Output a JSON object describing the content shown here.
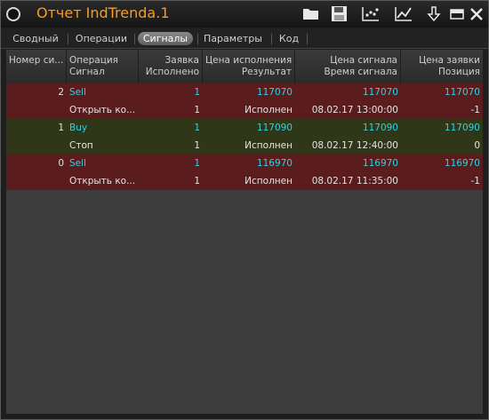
{
  "window": {
    "title": "Отчет IndTrenda.1"
  },
  "toolbar": {
    "icons": [
      "open-folder-icon",
      "save-icon",
      "scatter-chart-icon",
      "line-chart-icon",
      "download-arrow-icon",
      "minimize-icon",
      "close-icon"
    ]
  },
  "tabs": [
    {
      "label": "Сводный"
    },
    {
      "label": "Операции"
    },
    {
      "label": "Сигналы",
      "active": true
    },
    {
      "label": "Параметры"
    },
    {
      "label": "Код"
    }
  ],
  "columns": [
    {
      "line1": "Номер си...",
      "line2": ""
    },
    {
      "line1": "Операция",
      "line2": "Сигнал"
    },
    {
      "line1": "Заявка",
      "line2": "Исполнено"
    },
    {
      "line1": "Цена исполнения",
      "line2": "Результат"
    },
    {
      "line1": "Цена сигнала",
      "line2": "Время сигнала"
    },
    {
      "line1": "Цена заявки",
      "line2": "Позиция"
    }
  ],
  "signals": [
    {
      "top": [
        "2",
        "Sell",
        "1",
        "117070",
        "117070",
        "117070"
      ],
      "bottom": [
        "",
        "Открыть ко...",
        "1",
        "Исполнен",
        "08.02.17 13:00:00",
        "-1"
      ]
    },
    {
      "top": [
        "1",
        "Buy",
        "1",
        "117090",
        "117090",
        "117090"
      ],
      "bottom": [
        "",
        "Стоп",
        "1",
        "Исполнен",
        "08.02.17 12:40:00",
        "0"
      ]
    },
    {
      "top": [
        "0",
        "Sell",
        "1",
        "116970",
        "116970",
        "116970"
      ],
      "bottom": [
        "",
        "Открыть ко...",
        "1",
        "Исполнен",
        "08.02.17 11:35:00",
        "-1"
      ]
    }
  ],
  "colors": {
    "sell_row": "#5a1c1c",
    "buy_row": "#2f3718",
    "title": "#ff9a1a",
    "accent_value": "#2ad4e6"
  }
}
